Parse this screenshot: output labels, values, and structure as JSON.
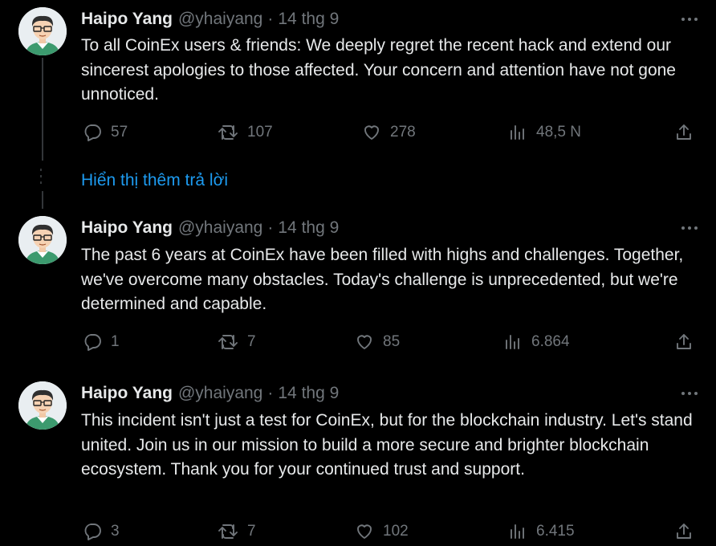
{
  "tweets": [
    {
      "author": "Haipo Yang",
      "handle": "@yhaiyang",
      "separator": "·",
      "time": "14 thg 9",
      "text": "To all CoinEx users & friends: We deeply regret the recent hack and extend our sincerest apologies to those affected. Your concern and attention have not gone unnoticed.",
      "replies": "57",
      "retweets": "107",
      "likes": "278",
      "views": "48,5 N"
    },
    {
      "author": "Haipo Yang",
      "handle": "@yhaiyang",
      "separator": "·",
      "time": "14 thg 9",
      "text": "The past 6 years at CoinEx have been filled with highs and challenges. Together, we've overcome many obstacles. Today's challenge is unprecedented, but we're determined and capable.",
      "replies": "1",
      "retweets": "7",
      "likes": "85",
      "views": "6.864"
    },
    {
      "author": "Haipo Yang",
      "handle": "@yhaiyang",
      "separator": "·",
      "time": "14 thg 9",
      "text": "This incident isn't just a test for CoinEx, but for the blockchain industry. Let's stand united. Join us in our mission to build a more secure and brighter blockchain ecosystem. Thank you for your continued trust and support.",
      "replies": "3",
      "retweets": "7",
      "likes": "102",
      "views": "6.415"
    }
  ],
  "show_more_replies": "Hiển thị thêm trả lời",
  "colors": {
    "background": "#000000",
    "text": "#e7e9ea",
    "muted": "#71767b",
    "link": "#1d9bf0"
  },
  "icons": [
    "reply-icon",
    "retweet-icon",
    "like-icon",
    "views-icon",
    "share-icon",
    "more-icon"
  ]
}
